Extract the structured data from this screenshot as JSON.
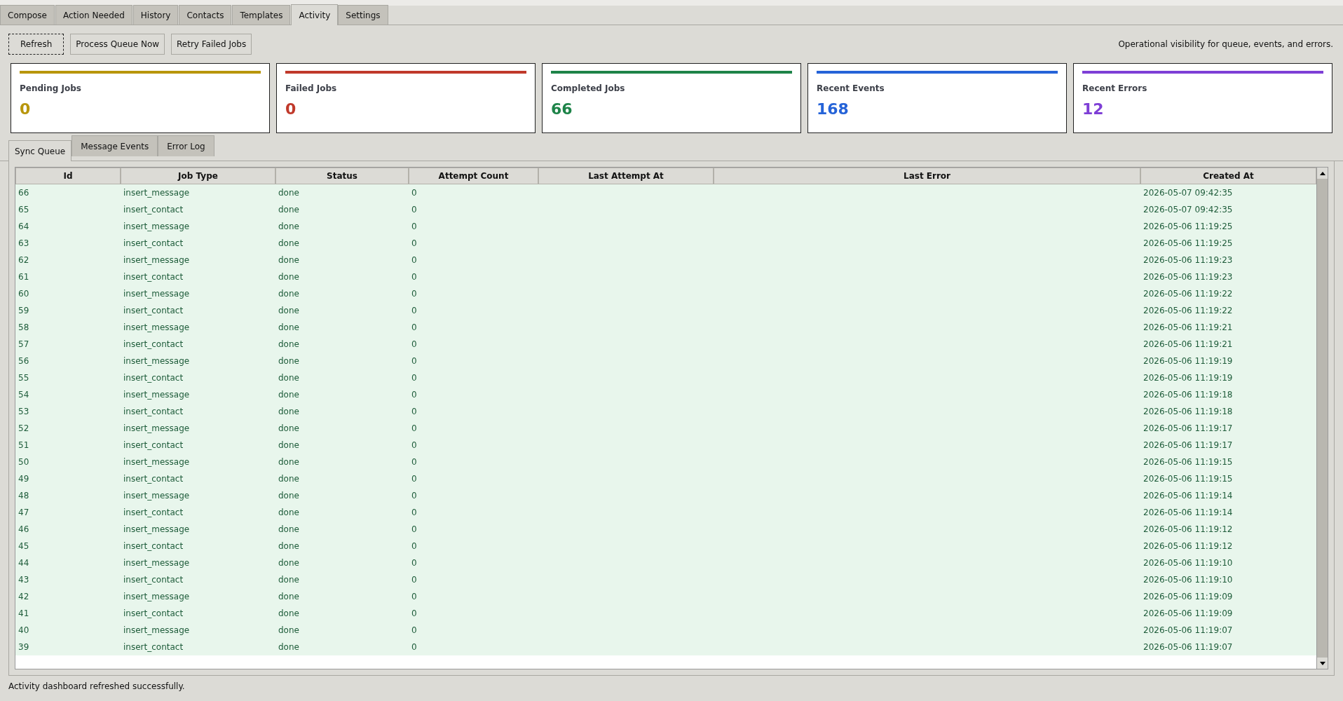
{
  "tabs": [
    {
      "label": "Compose",
      "selected": false
    },
    {
      "label": "Action Needed",
      "selected": false
    },
    {
      "label": "History",
      "selected": false
    },
    {
      "label": "Contacts",
      "selected": false
    },
    {
      "label": "Templates",
      "selected": false
    },
    {
      "label": "Activity",
      "selected": true
    },
    {
      "label": "Settings",
      "selected": false
    }
  ],
  "toolbar": {
    "buttons": [
      {
        "label": "Refresh",
        "focused": true
      },
      {
        "label": "Process Queue Now",
        "focused": false
      },
      {
        "label": "Retry Failed Jobs",
        "focused": false
      }
    ],
    "caption": "Operational visibility for queue, events, and errors."
  },
  "cards": [
    {
      "title": "Pending Jobs",
      "value": "0",
      "color": "#b8960c"
    },
    {
      "title": "Failed Jobs",
      "value": "0",
      "color": "#c0392b"
    },
    {
      "title": "Completed Jobs",
      "value": "66",
      "color": "#1e8449"
    },
    {
      "title": "Recent Events",
      "value": "168",
      "color": "#2563d8"
    },
    {
      "title": "Recent Errors",
      "value": "12",
      "color": "#7e3fd6"
    }
  ],
  "sub_tabs": [
    {
      "label": "Sync Queue",
      "selected": true
    },
    {
      "label": "Message Events",
      "selected": false
    },
    {
      "label": "Error Log",
      "selected": false
    }
  ],
  "table": {
    "columns": [
      "Id",
      "Job Type",
      "Status",
      "Attempt Count",
      "Last Attempt At",
      "Last Error",
      "Created At"
    ],
    "rows": [
      [
        "66",
        "insert_message",
        "done",
        "0",
        "",
        "",
        "2026-05-07 09:42:35"
      ],
      [
        "65",
        "insert_contact",
        "done",
        "0",
        "",
        "",
        "2026-05-07 09:42:35"
      ],
      [
        "64",
        "insert_message",
        "done",
        "0",
        "",
        "",
        "2026-05-06 11:19:25"
      ],
      [
        "63",
        "insert_contact",
        "done",
        "0",
        "",
        "",
        "2026-05-06 11:19:25"
      ],
      [
        "62",
        "insert_message",
        "done",
        "0",
        "",
        "",
        "2026-05-06 11:19:23"
      ],
      [
        "61",
        "insert_contact",
        "done",
        "0",
        "",
        "",
        "2026-05-06 11:19:23"
      ],
      [
        "60",
        "insert_message",
        "done",
        "0",
        "",
        "",
        "2026-05-06 11:19:22"
      ],
      [
        "59",
        "insert_contact",
        "done",
        "0",
        "",
        "",
        "2026-05-06 11:19:22"
      ],
      [
        "58",
        "insert_message",
        "done",
        "0",
        "",
        "",
        "2026-05-06 11:19:21"
      ],
      [
        "57",
        "insert_contact",
        "done",
        "0",
        "",
        "",
        "2026-05-06 11:19:21"
      ],
      [
        "56",
        "insert_message",
        "done",
        "0",
        "",
        "",
        "2026-05-06 11:19:19"
      ],
      [
        "55",
        "insert_contact",
        "done",
        "0",
        "",
        "",
        "2026-05-06 11:19:19"
      ],
      [
        "54",
        "insert_message",
        "done",
        "0",
        "",
        "",
        "2026-05-06 11:19:18"
      ],
      [
        "53",
        "insert_contact",
        "done",
        "0",
        "",
        "",
        "2026-05-06 11:19:18"
      ],
      [
        "52",
        "insert_message",
        "done",
        "0",
        "",
        "",
        "2026-05-06 11:19:17"
      ],
      [
        "51",
        "insert_contact",
        "done",
        "0",
        "",
        "",
        "2026-05-06 11:19:17"
      ],
      [
        "50",
        "insert_message",
        "done",
        "0",
        "",
        "",
        "2026-05-06 11:19:15"
      ],
      [
        "49",
        "insert_contact",
        "done",
        "0",
        "",
        "",
        "2026-05-06 11:19:15"
      ],
      [
        "48",
        "insert_message",
        "done",
        "0",
        "",
        "",
        "2026-05-06 11:19:14"
      ],
      [
        "47",
        "insert_contact",
        "done",
        "0",
        "",
        "",
        "2026-05-06 11:19:14"
      ],
      [
        "46",
        "insert_message",
        "done",
        "0",
        "",
        "",
        "2026-05-06 11:19:12"
      ],
      [
        "45",
        "insert_contact",
        "done",
        "0",
        "",
        "",
        "2026-05-06 11:19:12"
      ],
      [
        "44",
        "insert_message",
        "done",
        "0",
        "",
        "",
        "2026-05-06 11:19:10"
      ],
      [
        "43",
        "insert_contact",
        "done",
        "0",
        "",
        "",
        "2026-05-06 11:19:10"
      ],
      [
        "42",
        "insert_message",
        "done",
        "0",
        "",
        "",
        "2026-05-06 11:19:09"
      ],
      [
        "41",
        "insert_contact",
        "done",
        "0",
        "",
        "",
        "2026-05-06 11:19:09"
      ],
      [
        "40",
        "insert_message",
        "done",
        "0",
        "",
        "",
        "2026-05-06 11:19:07"
      ],
      [
        "39",
        "insert_contact",
        "done",
        "0",
        "",
        "",
        "2026-05-06 11:19:07"
      ]
    ]
  },
  "status_bar": "Activity dashboard refreshed successfully."
}
